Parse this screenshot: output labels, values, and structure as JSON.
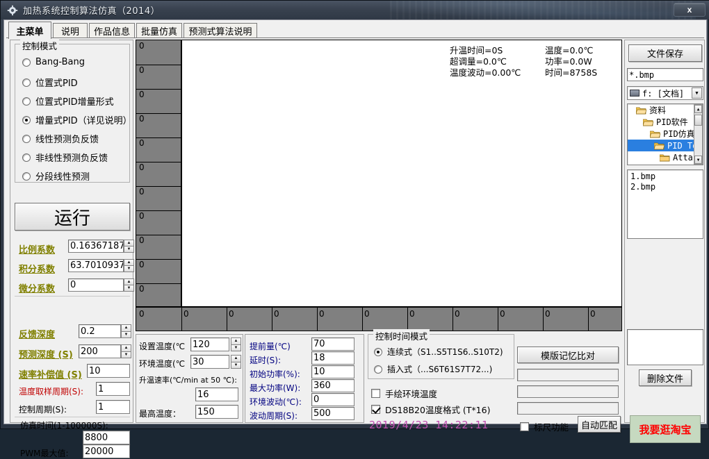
{
  "window": {
    "title": "加热系统控制算法仿真（2014）",
    "app_icon": "gear-icon",
    "close_label": "x"
  },
  "tabs": [
    {
      "label": "主菜单",
      "active": true
    },
    {
      "label": "说明",
      "active": false
    },
    {
      "label": "作品信息",
      "active": false
    },
    {
      "label": "批量仿真",
      "active": false
    },
    {
      "label": "预测式算法说明",
      "active": false
    }
  ],
  "control_mode": {
    "title": "控制模式",
    "options": [
      {
        "label": "Bang-Bang",
        "selected": false
      },
      {
        "label": "位置式PID",
        "selected": false
      },
      {
        "label": "位置式PID增量形式",
        "selected": false
      },
      {
        "label": "增量式PID（详见说明）",
        "selected": true
      },
      {
        "label": "线性预测负反馈",
        "selected": false
      },
      {
        "label": "非线性预测负反馈",
        "selected": false
      },
      {
        "label": "分段线性预测",
        "selected": false
      }
    ]
  },
  "run_button": {
    "label": "运行"
  },
  "pid_params": [
    {
      "label": "比例系数",
      "value": "0.163671875",
      "style": "olive",
      "spinner": true
    },
    {
      "label": "积分系数",
      "value": "63.70109375",
      "style": "olive",
      "spinner": true
    },
    {
      "label": "微分系数",
      "value": "0",
      "style": "olive",
      "spinner": true
    }
  ],
  "predict_params": [
    {
      "label": "反馈深度",
      "value": "0.2",
      "style": "olive",
      "spinner": true
    },
    {
      "label": "预测深度 (S)",
      "value": "200",
      "style": "olive",
      "spinner": true
    },
    {
      "label": "速率补偿值 (S)",
      "value": "10",
      "style": "olive",
      "spinner": false
    },
    {
      "label": "温度取样周期(S):",
      "value": "1",
      "style": "red",
      "spinner": false
    },
    {
      "label": "控制周期(S):",
      "value": "1",
      "style": "plain",
      "spinner": false
    }
  ],
  "sim_time": {
    "label": "仿真时间(1-100000S):",
    "value": "8800",
    "pwm_label": "PWM最大值:",
    "pwm_value": "20000"
  },
  "temp_settings": [
    {
      "label": "设置温度(℃",
      "value": "120",
      "spinner": true
    },
    {
      "label": "环境温度(℃",
      "value": "30",
      "spinner": true
    },
    {
      "label": "升温速率(℃/min at 50 ℃):",
      "value": "16",
      "spinner": false
    },
    {
      "label": "最高温度：",
      "value": "150",
      "spinner": false
    }
  ],
  "power_settings": [
    {
      "label": "提前量(℃)",
      "value": "70"
    },
    {
      "label": "延时(S):",
      "value": "18"
    },
    {
      "label": "初始功率(%):",
      "value": "10"
    },
    {
      "label": "最大功率(W):",
      "value": "360"
    },
    {
      "label": "环境波动(℃):",
      "value": "0"
    },
    {
      "label": "波动周期(S):",
      "value": "500"
    }
  ],
  "time_mode": {
    "title": "控制时间模式",
    "options": [
      {
        "label": "连续式（S1..S5T1S6..S10T2)",
        "selected": true
      },
      {
        "label": "插入式（...S6T61S7T72...)",
        "selected": false
      }
    ]
  },
  "checkboxes": [
    {
      "label": "手绘环境温度",
      "checked": false
    },
    {
      "label": "DS18B20温度格式 (T*16)",
      "checked": true
    }
  ],
  "clock": "2019/4/23  14:22:11",
  "ruler": {
    "label": "标尺功能",
    "checked": false
  },
  "buttons": {
    "template_compare": "模版记忆比对",
    "auto_match": "自动匹配",
    "file_save": "文件保存",
    "delete_file": "删除文件",
    "taobao": "我要逛淘宝"
  },
  "template_fields": [
    "",
    "",
    ""
  ],
  "file_browser": {
    "filter": "*.bmp",
    "drive": "f: [文档]",
    "drive_icon": "drive-icon",
    "tree": [
      {
        "label": "资料",
        "indent": 0,
        "selected": false
      },
      {
        "label": "PID软件",
        "indent": 1,
        "selected": false
      },
      {
        "label": "PID仿真工具",
        "indent": 2,
        "selected": false
      },
      {
        "label": "PID Tool",
        "indent": 3,
        "selected": true
      },
      {
        "label": "Attach",
        "indent": 4,
        "selected": false
      }
    ],
    "files": [
      "1.bmp",
      "2.bmp"
    ],
    "preview_value": ""
  },
  "chart_data": {
    "type": "line",
    "title": "",
    "xlabel": "",
    "ylabel": "",
    "grid": true,
    "series": [],
    "y_ticks": [
      "0",
      "0",
      "0",
      "0",
      "0",
      "0",
      "0",
      "0",
      "0",
      "0",
      "0"
    ],
    "x_ticks": [
      "0",
      "0",
      "0",
      "0",
      "0",
      "0",
      "0",
      "0",
      "0",
      "0",
      "0"
    ],
    "readouts_left": [
      "升温时间=0S",
      "超调量=0.0℃",
      "温度波动=0.00℃"
    ],
    "readouts_right": [
      "温度=0.0℃",
      "功率=0.0W",
      "时间=8758S"
    ]
  },
  "colors": {
    "accent_olive": "#808000",
    "accent_red": "#c00000",
    "accent_navy": "#000080",
    "selection_blue": "#2a7fe0",
    "axis_gray": "#808080",
    "clock_purple": "#c050b0"
  }
}
